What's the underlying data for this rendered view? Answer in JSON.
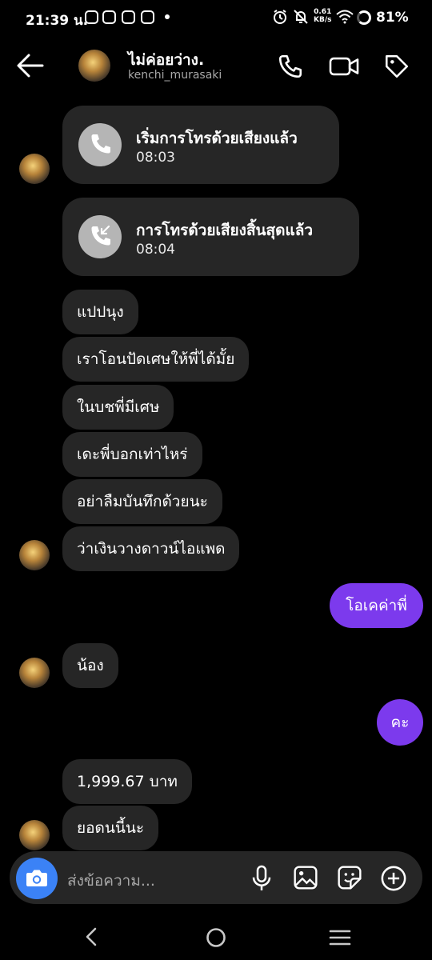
{
  "status_bar": {
    "time": "21:39 น.",
    "net_speed_value": "0.61",
    "net_speed_unit": "KB/s",
    "battery": "81%"
  },
  "header": {
    "name": "ไม่ค่อยว่าง.",
    "username": "kenchi_murasaki",
    "icons": [
      "back-arrow-icon",
      "phone-icon",
      "video-icon",
      "tag-icon"
    ]
  },
  "messages": {
    "call_start": {
      "title": "เริ่มการโทรด้วยเสียงแล้ว",
      "time": "08:03"
    },
    "call_end": {
      "title": "การโทรด้วยเสียงสิ้นสุดแล้ว",
      "time": "08:04"
    },
    "in_1": "แปปนุง",
    "in_2": "เราโอนปัดเศษให้พี่ได้มั้ย",
    "in_3": "ในบชพี่มีเศษ",
    "in_4": "เดะพี่บอกเท่าไหร่",
    "in_5": "อย่าลืมบันทึกด้วยนะ",
    "in_6": "ว่าเงินวางดาวน์ไอแพด",
    "out_1": "โอเคค่าพี่",
    "in_7": "น้อง",
    "out_2": "คะ",
    "in_8": "1,999.67 บาท",
    "in_9": "ยอดนนี้นะ"
  },
  "composer": {
    "placeholder": "ส่งข้อความ..."
  },
  "colors": {
    "background": "#000000",
    "incoming_bubble": "#262626",
    "outgoing_bubble": "#7c3aed",
    "camera_button": "#3b82f6",
    "secondary_text": "#a8a8a8"
  }
}
